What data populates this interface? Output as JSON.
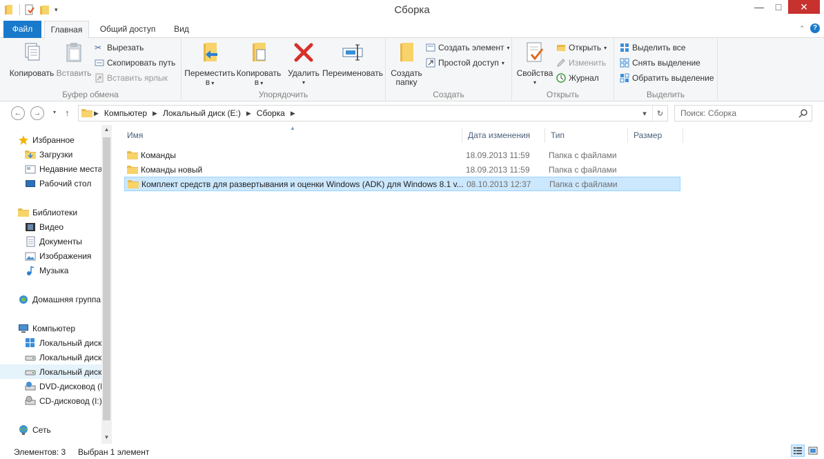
{
  "window": {
    "title": "Сборка"
  },
  "tabs": {
    "file": "Файл",
    "home": "Главная",
    "share": "Общий доступ",
    "view": "Вид"
  },
  "ribbon": {
    "clipboard": {
      "label": "Буфер обмена",
      "copy": "Копировать",
      "paste": "Вставить",
      "cut": "Вырезать",
      "copy_path": "Скопировать путь",
      "paste_shortcut": "Вставить ярлык"
    },
    "organize": {
      "label": "Упорядочить",
      "move_to_line1": "Переместить",
      "move_to_line2": "в",
      "copy_to_line1": "Копировать",
      "copy_to_line2": "в",
      "delete": "Удалить",
      "rename": "Переименовать"
    },
    "new": {
      "label": "Создать",
      "new_folder_line1": "Создать",
      "new_folder_line2": "папку",
      "new_item": "Создать элемент",
      "easy_access": "Простой доступ"
    },
    "open": {
      "label": "Открыть",
      "properties": "Свойства",
      "open": "Открыть",
      "edit": "Изменить",
      "history": "Журнал"
    },
    "select": {
      "label": "Выделить",
      "select_all": "Выделить все",
      "select_none": "Снять выделение",
      "invert": "Обратить выделение"
    }
  },
  "address": {
    "crumbs": [
      "Компьютер",
      "Локальный диск (E:)",
      "Сборка"
    ],
    "search_placeholder": "Поиск: Сборка"
  },
  "nav": {
    "favorites": "Избранное",
    "downloads": "Загрузки",
    "recent": "Недавние места",
    "desktop": "Рабочий стол",
    "libraries": "Библиотеки",
    "video": "Видео",
    "documents": "Документы",
    "pictures": "Изображения",
    "music": "Музыка",
    "homegroup": "Домашняя группа",
    "computer": "Компьютер",
    "disk1": "Локальный диск",
    "disk2": "Локальный диск",
    "disk3": "Локальный диск",
    "dvd": "DVD-дисковод (H",
    "cd": "CD-дисковод (I:)",
    "network": "Сеть"
  },
  "columns": {
    "name": "Имя",
    "date": "Дата изменения",
    "type": "Тип",
    "size": "Размер"
  },
  "files": [
    {
      "name": "Команды",
      "date": "18.09.2013 11:59",
      "type": "Папка с файлами"
    },
    {
      "name": "Команды новый",
      "date": "18.09.2013 11:59",
      "type": "Папка с файлами"
    },
    {
      "name": "Комплект средств для развертывания и оценки Windows (ADK) для Windows 8.1 v...",
      "date": "08.10.2013 12:37",
      "type": "Папка с файлами"
    }
  ],
  "status": {
    "count": "Элементов: 3",
    "selected": "Выбран 1 элемент"
  },
  "colors": {
    "accent": "#1979ca",
    "close": "#c7312e",
    "selection": "#cce8ff",
    "folder": "#e8b84a"
  }
}
